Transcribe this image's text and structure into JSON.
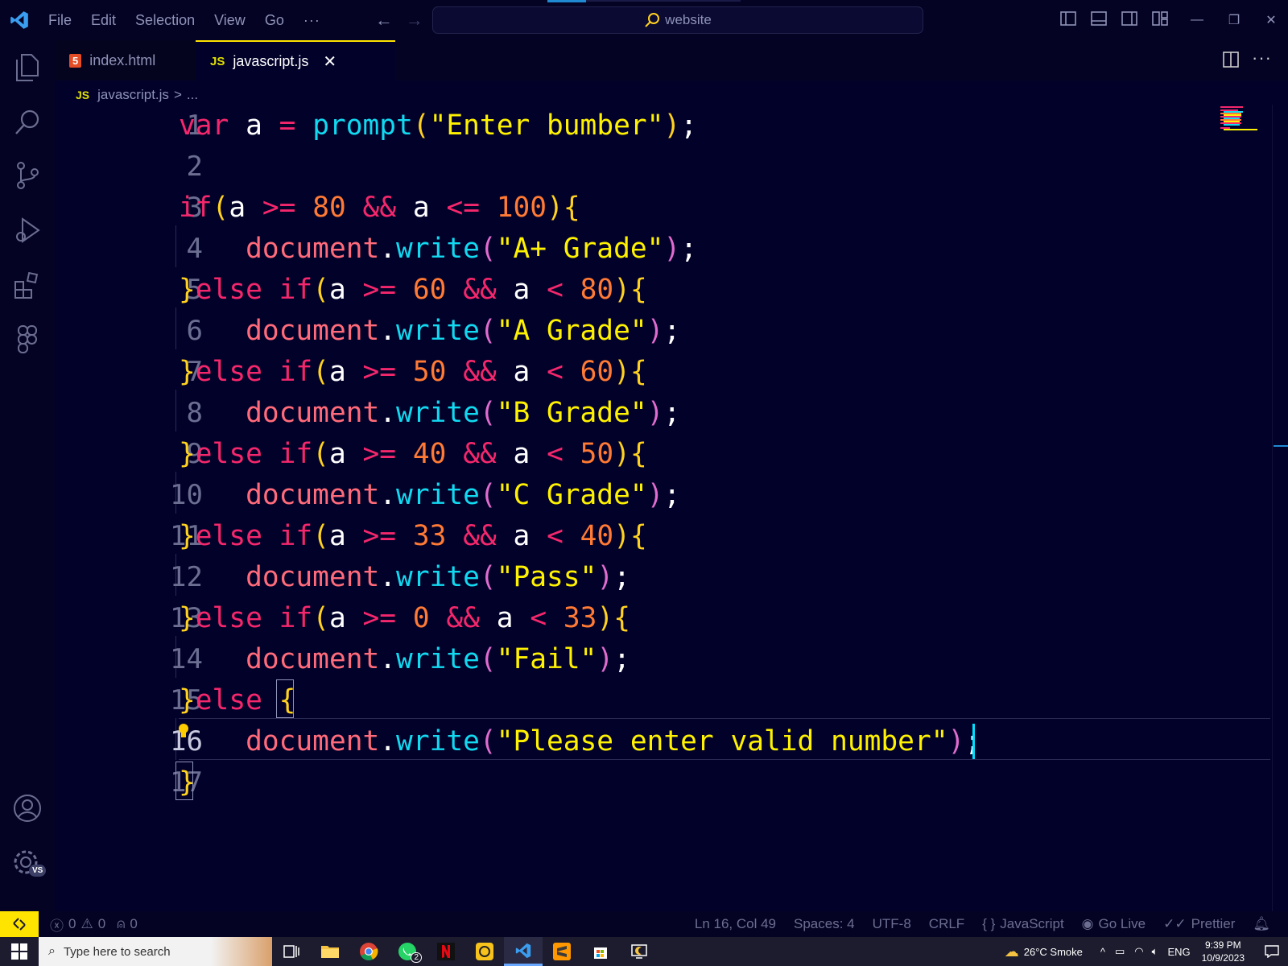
{
  "menu": [
    "File",
    "Edit",
    "Selection",
    "View",
    "Go",
    "···"
  ],
  "search": {
    "text": "website"
  },
  "tabs": [
    {
      "label": "index.html",
      "badge": "5"
    },
    {
      "label": "javascript.js",
      "badge": "JS",
      "close": "✕"
    }
  ],
  "breadcrumb": {
    "badge": "JS",
    "file": "javascript.js",
    "sep": ">",
    "rest": "..."
  },
  "editor": {
    "line_numbers": [
      "1",
      "2",
      "3",
      "4",
      "5",
      "6",
      "7",
      "8",
      "9",
      "10",
      "11",
      "12",
      "13",
      "14",
      "15",
      "16",
      "17"
    ],
    "current_line": 16
  },
  "status": {
    "errors": "0",
    "warnings": "0",
    "ports": "0",
    "position": "Ln 16, Col 49",
    "spaces": "Spaces: 4",
    "encoding": "UTF-8",
    "eol": "CRLF",
    "language": "JavaScript",
    "golive": "Go Live",
    "prettier": "Prettier"
  },
  "activity_badge": "VS",
  "taskbar": {
    "search_placeholder": "Type here to search",
    "whatsapp_badge": "2",
    "weather": "26°C  Smoke",
    "lang": "ENG",
    "time": "9:39 PM",
    "date": "10/9/2023"
  },
  "colors": {
    "accent": "#ffe400",
    "keyword": "#f5276c",
    "function": "#11d9f0",
    "string": "#fff200",
    "number": "#ff7a34",
    "background": "#02012a"
  }
}
